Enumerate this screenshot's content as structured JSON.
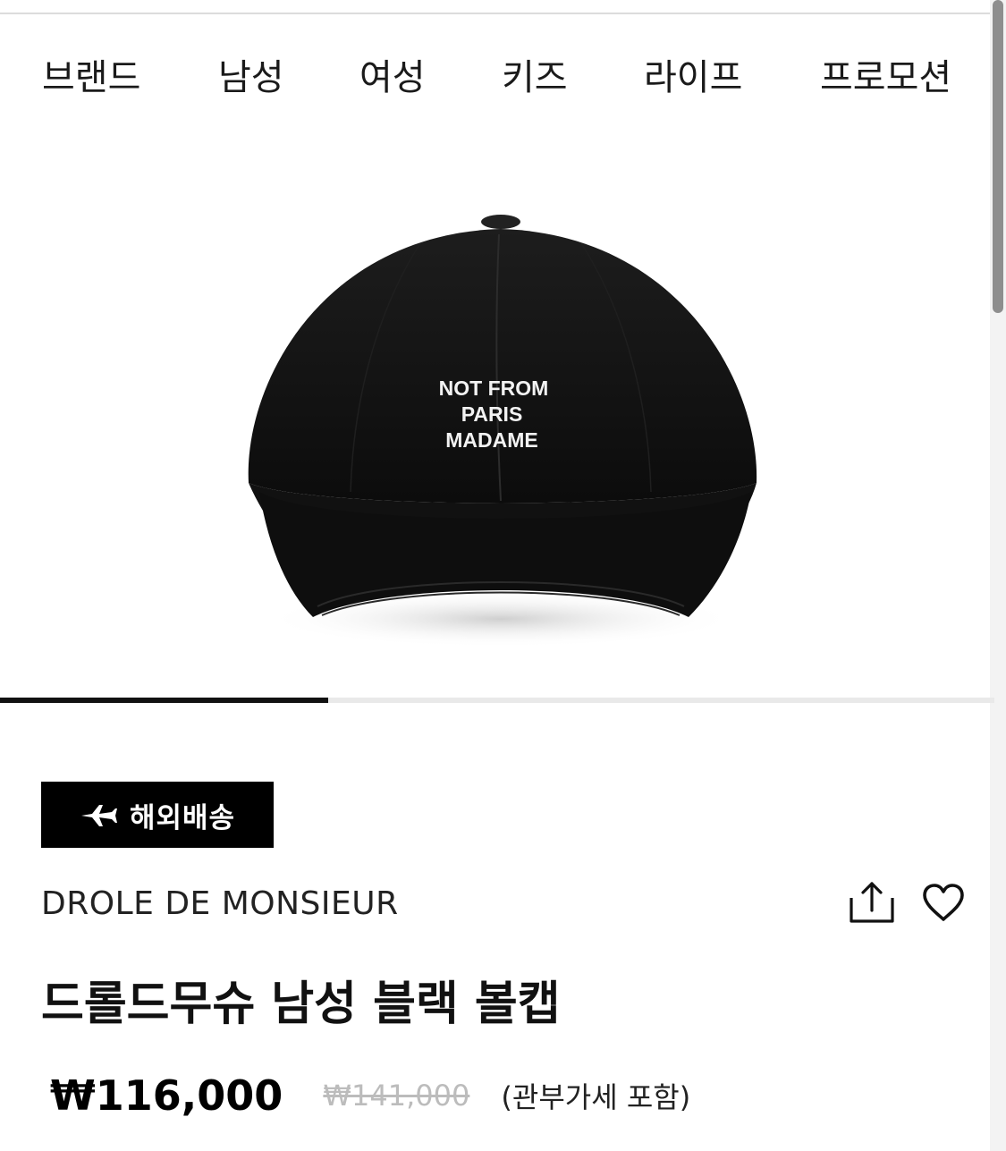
{
  "nav": {
    "items": [
      {
        "label": "브랜드"
      },
      {
        "label": "남성"
      },
      {
        "label": "여성"
      },
      {
        "label": "키즈"
      },
      {
        "label": "라이프"
      },
      {
        "label": "프로모션"
      }
    ]
  },
  "product": {
    "image": {
      "description_icon": "black-baseball-cap",
      "print_lines": [
        "NOT FROM",
        "PARIS",
        "MADAME"
      ]
    },
    "carousel_progress": 0.33,
    "badge": {
      "icon": "airplane-icon",
      "label": "해외배송"
    },
    "brand": "DROLE DE MONSIEUR",
    "title": "드롤드무슈 남성 블랙 볼캡",
    "price": {
      "current": "₩116,000",
      "original": "₩141,000",
      "note": "(관부가세 포함)"
    },
    "actions": {
      "share_icon": "share-icon",
      "wishlist_icon": "heart-icon"
    }
  },
  "colors": {
    "accent": "#000000",
    "muted": "#bcbcbc"
  }
}
